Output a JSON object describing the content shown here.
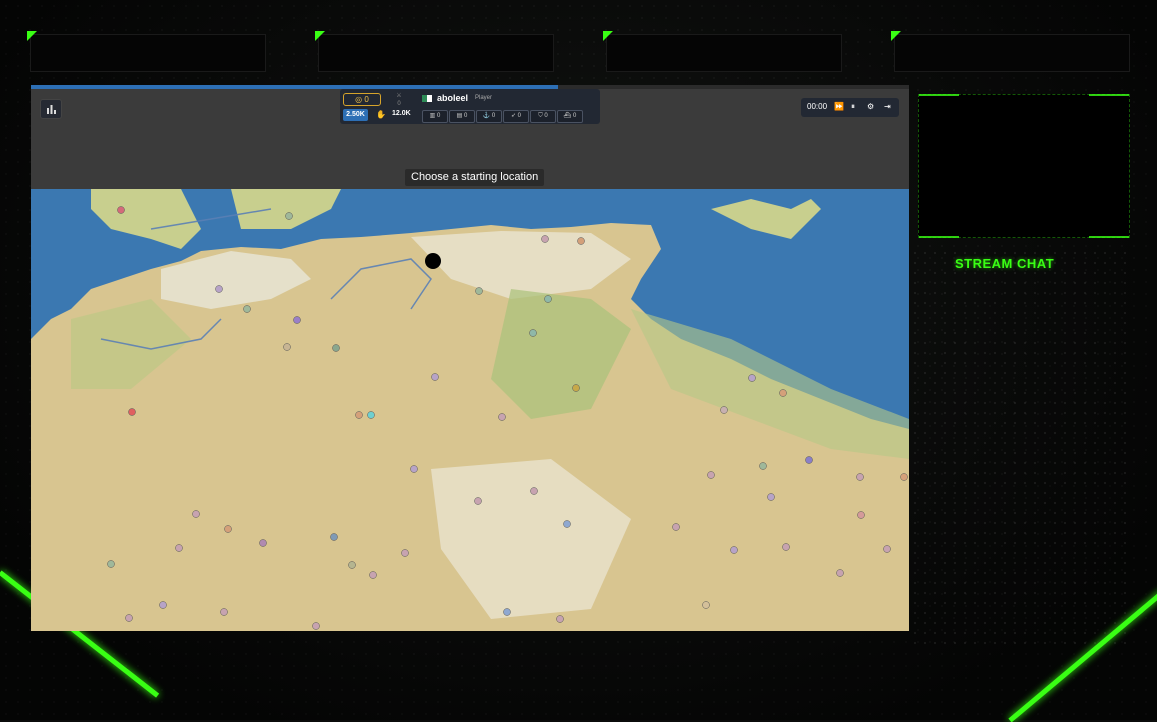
{
  "hud": {
    "gold": "0",
    "troops": "0",
    "player_name": "aboleel",
    "player_role": "Player",
    "population": "2.50K",
    "max_population": "12.0K",
    "buildings": [
      {
        "icon": "city-icon",
        "count": "0"
      },
      {
        "icon": "factory-icon",
        "count": "0"
      },
      {
        "icon": "port-icon",
        "count": "0"
      },
      {
        "icon": "missile-icon",
        "count": "0"
      },
      {
        "icon": "defense-icon",
        "count": "0"
      },
      {
        "icon": "warship-icon",
        "count": "0"
      }
    ]
  },
  "timer": "00:00",
  "banner": "Choose a starting location",
  "stream": {
    "chat_title": "STREAM CHAT"
  },
  "colors": {
    "neon": "#39ff14",
    "water": "#3b78b1",
    "land": "#d8c590",
    "green_land": "#a9c27a"
  }
}
